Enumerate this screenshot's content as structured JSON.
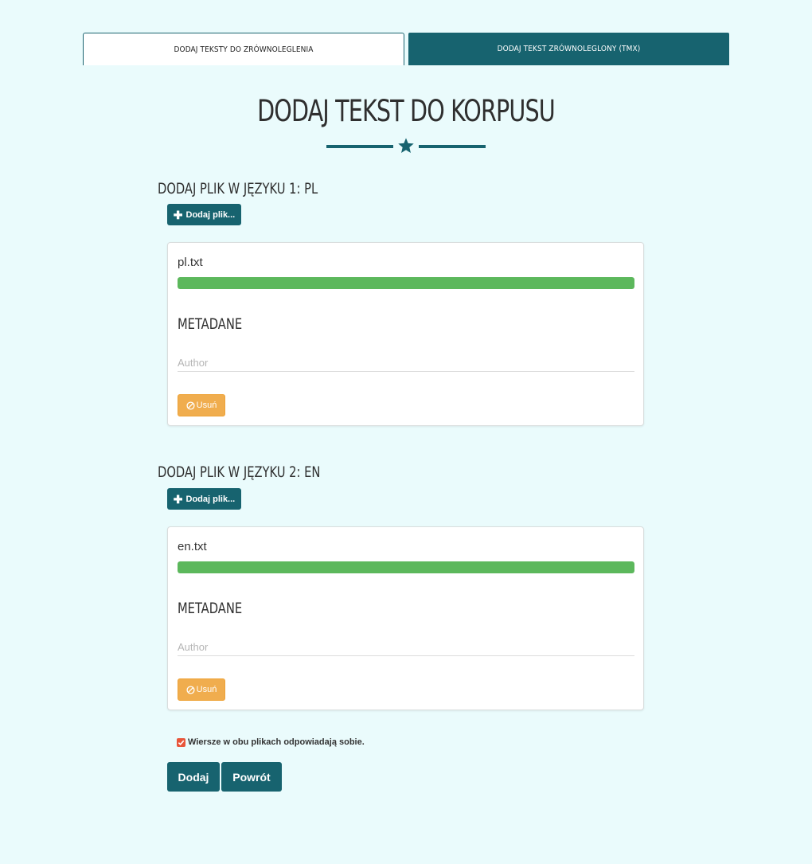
{
  "tabs": [
    {
      "label": "Dodaj teksty do zrównoleglenia",
      "active": true
    },
    {
      "label": "Dodaj tekst zrównoleglony (TMX)",
      "active": false
    }
  ],
  "title": "Dodaj tekst do korpusu",
  "sections": [
    {
      "heading": "Dodaj plik w języku 1: PL",
      "add_button": "Dodaj plik...",
      "file": {
        "name": "pl.txt",
        "progress": 1.0,
        "metadata_title": "Metadane",
        "author_placeholder": "Author",
        "author_value": "",
        "remove_label": "Usuń"
      }
    },
    {
      "heading": "Dodaj plik w języku 2: EN",
      "add_button": "Dodaj plik...",
      "file": {
        "name": "en.txt",
        "progress": 1.0,
        "metadata_title": "Metadane",
        "author_placeholder": "Author",
        "author_value": "",
        "remove_label": "Usuń"
      }
    }
  ],
  "checkbox": {
    "label": "Wiersze w obu plikach odpowiadają sobie.",
    "checked": true
  },
  "buttons": {
    "add": "Dodaj",
    "back": "Powrót"
  },
  "colors": {
    "accent": "#17636f",
    "background": "#eafbfc",
    "progress": "#5cb85c",
    "warning": "#f0ad4e",
    "checkbox": "#e8553a"
  },
  "icons": {
    "divider": "star-icon",
    "add_file": "plus-icon",
    "remove": "ban-icon",
    "checkbox": "checkmark-icon"
  }
}
